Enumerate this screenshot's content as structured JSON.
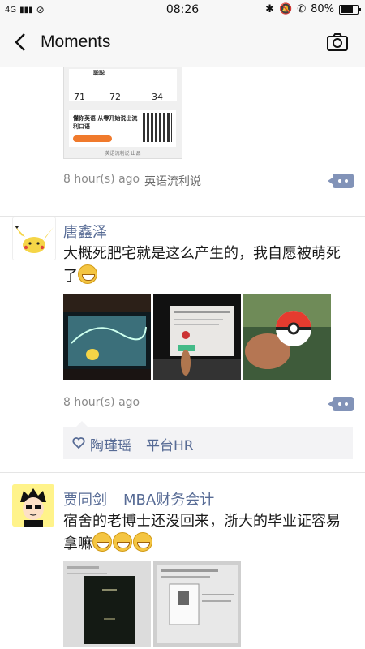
{
  "status_bar": {
    "network": "4G",
    "time": "08:26",
    "battery": "80%"
  },
  "nav": {
    "title": "Moments"
  },
  "shared_card": {
    "name": "聪聪",
    "stats": [
      "71",
      "72",
      "34"
    ],
    "ad_text": "懂你英语 从零开始说出流利口语",
    "footer": "英语流利说 出品"
  },
  "post0": {
    "time": "8 hour(s) ago",
    "source": "英语流利说"
  },
  "post1": {
    "author": "唐鑫泽",
    "text": "大概死肥宅就是这么产生的，我自愿被萌死了",
    "time": "8 hour(s) ago",
    "likes": [
      "陶瑾瑶",
      "平台HR"
    ]
  },
  "post2": {
    "author": "贾同剑",
    "tag": "MBA财务会计",
    "text": "宿舍的老博士还没回来，浙大的毕业证容易拿嘛"
  },
  "colors": {
    "link": "#576b95",
    "more_button": "#8293b8"
  }
}
